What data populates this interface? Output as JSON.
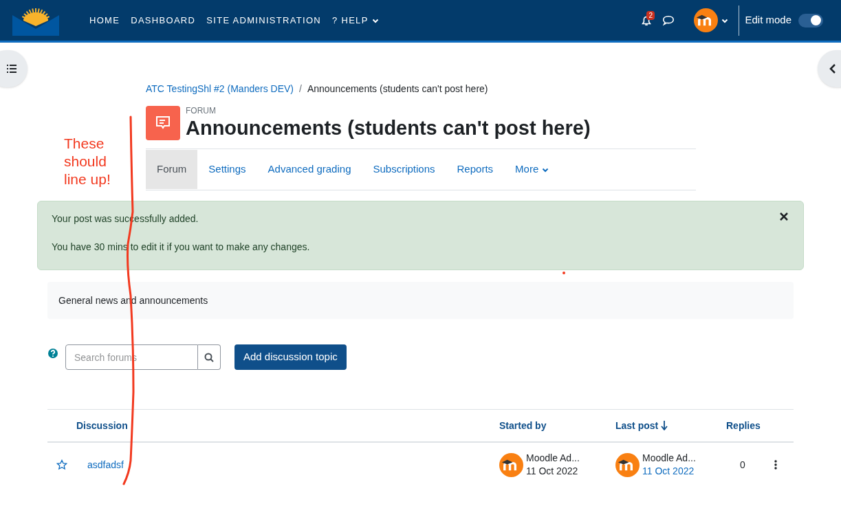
{
  "navbar": {
    "menu": [
      {
        "label": "HOME",
        "dropdown": false
      },
      {
        "label": "DASHBOARD",
        "dropdown": false
      },
      {
        "label": "SITE ADMINISTRATION",
        "dropdown": false
      },
      {
        "label": "? HELP",
        "dropdown": true
      }
    ],
    "notification_count": "2",
    "edit_mode": {
      "label": "Edit mode",
      "on": true
    }
  },
  "breadcrumb": {
    "separator": "/",
    "items": [
      {
        "label": "ATC TestingShl #2 (Manders DEV)",
        "link": true
      },
      {
        "label": "Announcements (students can't post here)",
        "link": false
      }
    ]
  },
  "page_header": {
    "kicker": "FORUM",
    "title": "Announcements (students can't post here)"
  },
  "tabs": [
    {
      "label": "Forum",
      "selected": true,
      "dropdown": false
    },
    {
      "label": "Settings",
      "selected": false,
      "dropdown": false
    },
    {
      "label": "Advanced grading",
      "selected": false,
      "dropdown": false
    },
    {
      "label": "Subscriptions",
      "selected": false,
      "dropdown": false
    },
    {
      "label": "Reports",
      "selected": false,
      "dropdown": false
    },
    {
      "label": "More",
      "selected": false,
      "dropdown": true
    }
  ],
  "alert": {
    "lines": [
      "Your post was successfully added.",
      "You have 30 mins to edit it if you want to make any changes."
    ]
  },
  "intro": "General news and announcements",
  "search": {
    "placeholder": "Search forums"
  },
  "add_button": "Add discussion topic",
  "table": {
    "columns": [
      {
        "label": "Discussion",
        "sorted": false
      },
      {
        "label": "Started by",
        "sorted": false
      },
      {
        "label": "Last post",
        "sorted": true
      },
      {
        "label": "Replies",
        "sorted": false
      }
    ],
    "rows": [
      {
        "starred": false,
        "title": "asdfadsf",
        "started_by": {
          "name": "Moodle Ad...",
          "date": "11 Oct 2022"
        },
        "last_post": {
          "name": "Moodle Ad...",
          "date": "11 Oct 2022"
        },
        "replies": "0"
      }
    ]
  },
  "annotation": {
    "text": "These should line up!"
  }
}
